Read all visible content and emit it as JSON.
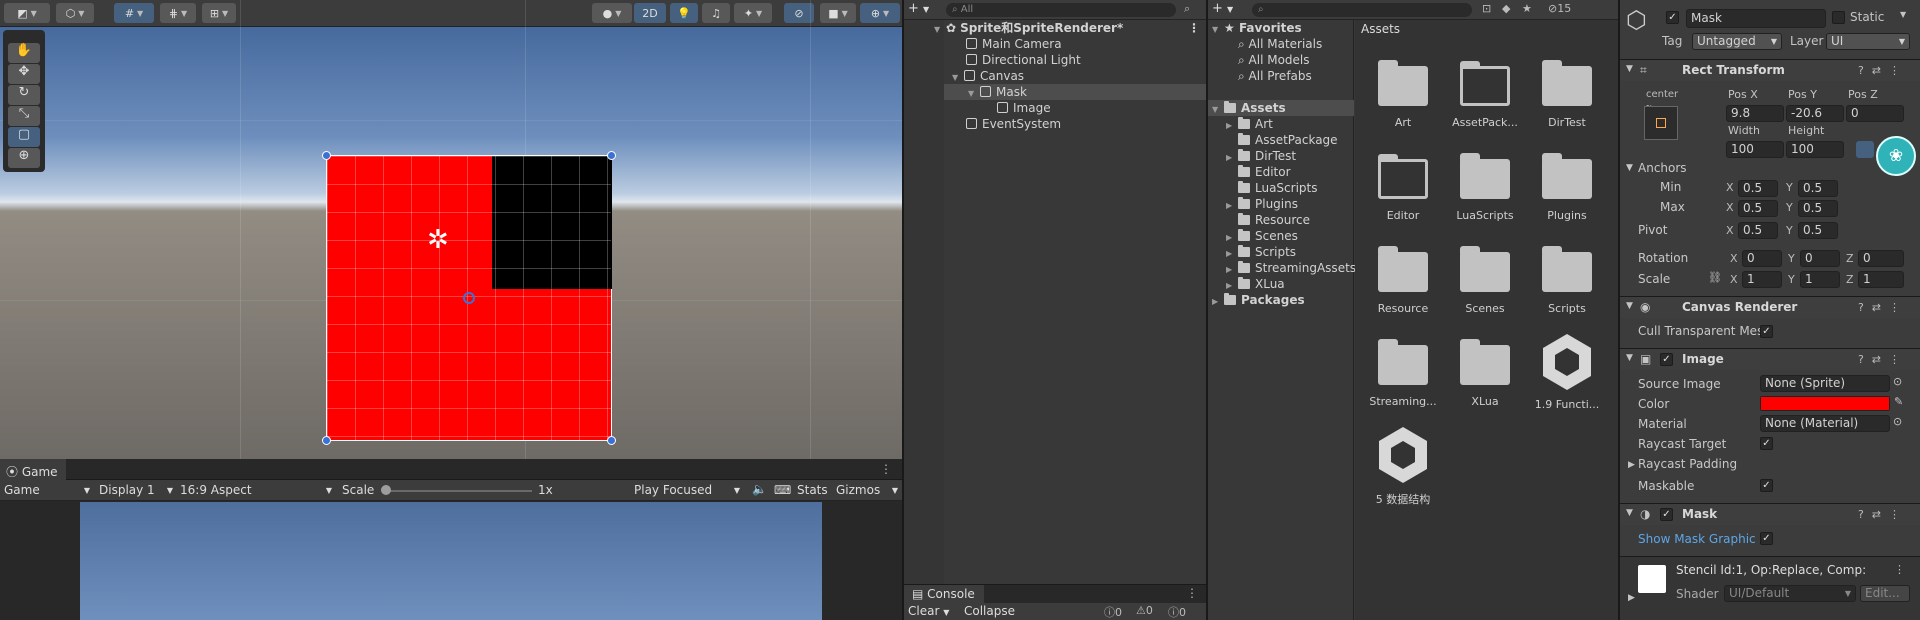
{
  "scene": {
    "toolbar": {
      "toggle_2d": "2D"
    }
  },
  "game": {
    "tab_label": "Game",
    "display_mode": "Game",
    "display": "Display 1",
    "aspect": "16:9 Aspect",
    "scale_label": "Scale",
    "scale_value": "1x",
    "play_mode": "Play Focused",
    "stats": "Stats",
    "gizmos": "Gizmos"
  },
  "hierarchy": {
    "search_placeholder": "All",
    "scene_name": "Sprite和SpriteRenderer*",
    "items": [
      {
        "label": "Main Camera"
      },
      {
        "label": "Directional Light"
      },
      {
        "label": "Canvas"
      },
      {
        "label": "Mask"
      },
      {
        "label": "Image"
      },
      {
        "label": "EventSystem"
      }
    ]
  },
  "console": {
    "tab_label": "Console",
    "clear": "Clear",
    "collapse": "Collapse",
    "counts": [
      "0",
      "0",
      "0"
    ]
  },
  "project": {
    "badge": "15",
    "favorites_label": "Favorites",
    "favorites": [
      "All Materials",
      "All Models",
      "All Prefabs"
    ],
    "assets_label": "Assets",
    "tree": [
      "Art",
      "AssetPackage",
      "DirTest",
      "Editor",
      "LuaScripts",
      "Plugins",
      "Resource",
      "Scenes",
      "Scripts",
      "StreamingAssets",
      "XLua"
    ],
    "packages_label": "Packages",
    "grid_title": "Assets",
    "grid": [
      {
        "label": "Art",
        "icon": "folder-icon"
      },
      {
        "label": "AssetPack...",
        "icon": "empty-folder-icon"
      },
      {
        "label": "DirTest",
        "icon": "folder-icon"
      },
      {
        "label": "Editor",
        "icon": "empty-folder-icon"
      },
      {
        "label": "LuaScripts",
        "icon": "folder-icon"
      },
      {
        "label": "Plugins",
        "icon": "folder-icon"
      },
      {
        "label": "Resource",
        "icon": "folder-icon"
      },
      {
        "label": "Scenes",
        "icon": "folder-icon"
      },
      {
        "label": "Scripts",
        "icon": "folder-icon"
      },
      {
        "label": "Streaming...",
        "icon": "folder-icon"
      },
      {
        "label": "XLua",
        "icon": "folder-icon"
      },
      {
        "label": "1.9 Functi...",
        "icon": "unity-scene-icon"
      },
      {
        "label": "5 数据结构",
        "icon": "unity-scene-icon"
      }
    ]
  },
  "inspector": {
    "object_name": "Mask",
    "static_label": "Static",
    "tag_label": "Tag",
    "tag_value": "Untagged",
    "layer_label": "Layer",
    "layer_value": "UI",
    "rect_transform": {
      "title": "Rect Transform",
      "anchor_h": "center",
      "anchor_v": "middle",
      "pos_x_label": "Pos X",
      "pos_x": "9.8",
      "pos_y_label": "Pos Y",
      "pos_y": "-20.6",
      "pos_z_label": "Pos Z",
      "pos_z": "0",
      "width_label": "Width",
      "width": "100",
      "height_label": "Height",
      "height": "100",
      "anchors_label": "Anchors",
      "min_label": "Min",
      "min_x": "0.5",
      "min_y": "0.5",
      "max_label": "Max",
      "max_x": "0.5",
      "max_y": "0.5",
      "pivot_label": "Pivot",
      "pivot_x": "0.5",
      "pivot_y": "0.5",
      "rotation_label": "Rotation",
      "rot_x": "0",
      "rot_y": "0",
      "rot_z": "0",
      "scale_label": "Scale",
      "scale_x": "1",
      "scale_y": "1",
      "scale_z": "1"
    },
    "canvas_renderer": {
      "title": "Canvas Renderer",
      "cull_label": "Cull Transparent Mes"
    },
    "image": {
      "title": "Image",
      "source_label": "Source Image",
      "source_value": "None (Sprite)",
      "color_label": "Color",
      "color_value": "#ff0000",
      "material_label": "Material",
      "material_value": "None (Material)",
      "raycast_target_label": "Raycast Target",
      "raycast_padding_label": "Raycast Padding",
      "maskable_label": "Maskable"
    },
    "mask": {
      "title": "Mask",
      "show_graphic_label": "Show Mask Graphic"
    },
    "material_info": {
      "stencil": "Stencil Id:1, Op:Replace, Comp:",
      "shader_label": "Shader",
      "shader_value": "UI/Default",
      "edit": "Edit..."
    }
  }
}
